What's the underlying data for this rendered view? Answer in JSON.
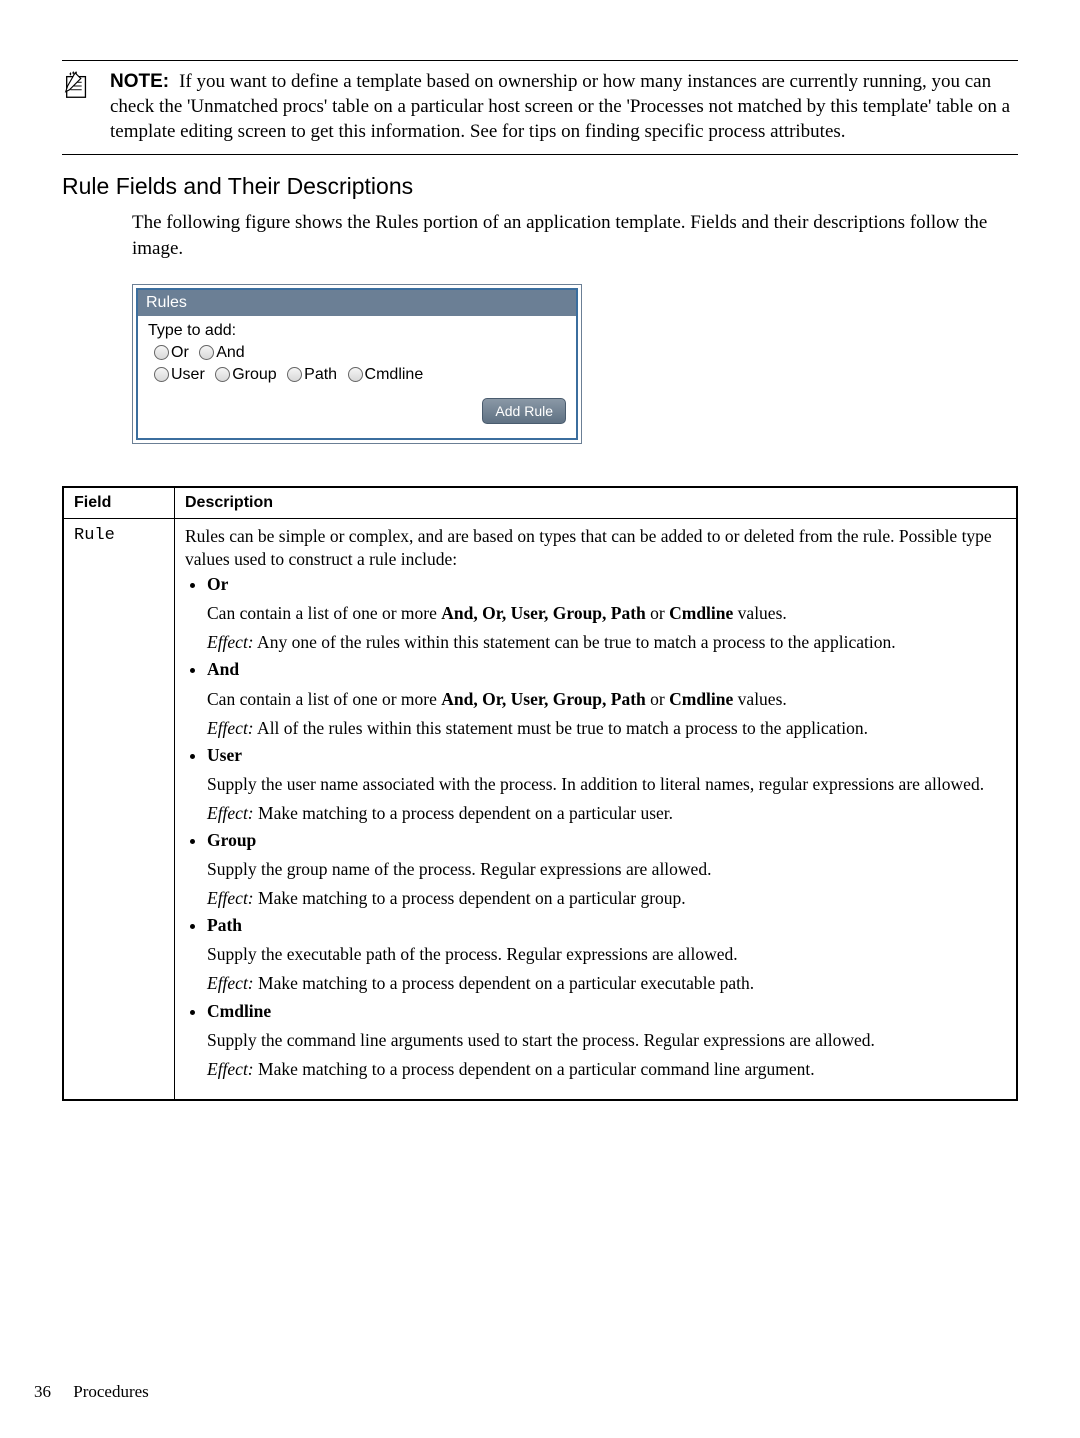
{
  "note": {
    "label": "NOTE:",
    "text": "If you want to define a template based on ownership or how many instances are currently running, you can check the 'Unmatched procs' table on a particular host screen or the 'Processes not matched by this template' table on a template editing screen to get this information. See for tips on finding specific process attributes."
  },
  "section_heading": "Rule Fields and Their Descriptions",
  "intro": "The following figure shows the Rules portion of an application template. Fields and their descriptions follow the image.",
  "rules_panel": {
    "title": "Rules",
    "type_label": "Type to add:",
    "row1": [
      "Or",
      "And"
    ],
    "row2": [
      "User",
      "Group",
      "Path",
      "Cmdline"
    ],
    "button": "Add Rule"
  },
  "table": {
    "headers": {
      "field": "Field",
      "description": "Description"
    },
    "row": {
      "field": "Rule",
      "intro": "Rules can be simple or complex, and are based on types that can be added to or deleted from the rule. Possible type values used to construct a rule include:",
      "items": [
        {
          "name": "Or",
          "p1_pre": "Can contain a list of one or more ",
          "p1_values": "And, Or, User, Group, Path",
          "p1_or": " or ",
          "p1_last": "Cmdline",
          "p1_post": " values.",
          "effect": " Any one of the rules within this statement can be true to match a process to the application."
        },
        {
          "name": "And",
          "p1_pre": "Can contain a list of one or more ",
          "p1_values": "And, Or, User, Group, Path",
          "p1_or": " or ",
          "p1_last": "Cmdline",
          "p1_post": " values.",
          "effect": " All of the rules within this statement must be true to match a process to the application."
        },
        {
          "name": "User",
          "desc": "Supply the user name associated with the process. In addition to literal names, regular expressions are allowed.",
          "effect": " Make matching to a process dependent on a particular user."
        },
        {
          "name": "Group",
          "desc": "Supply the group name of the process. Regular expressions are allowed.",
          "effect": " Make matching to a process dependent on a particular group."
        },
        {
          "name": "Path",
          "desc": "Supply the executable path of the process. Regular expressions are allowed.",
          "effect": " Make matching to a process dependent on a particular executable path."
        },
        {
          "name": "Cmdline",
          "desc": "Supply the command line arguments used to start the process. Regular expressions are allowed.",
          "effect": " Make matching to a process dependent on a particular command line argument."
        }
      ],
      "effect_label": "Effect:"
    }
  },
  "footer": {
    "page": "36",
    "section": "Procedures"
  }
}
